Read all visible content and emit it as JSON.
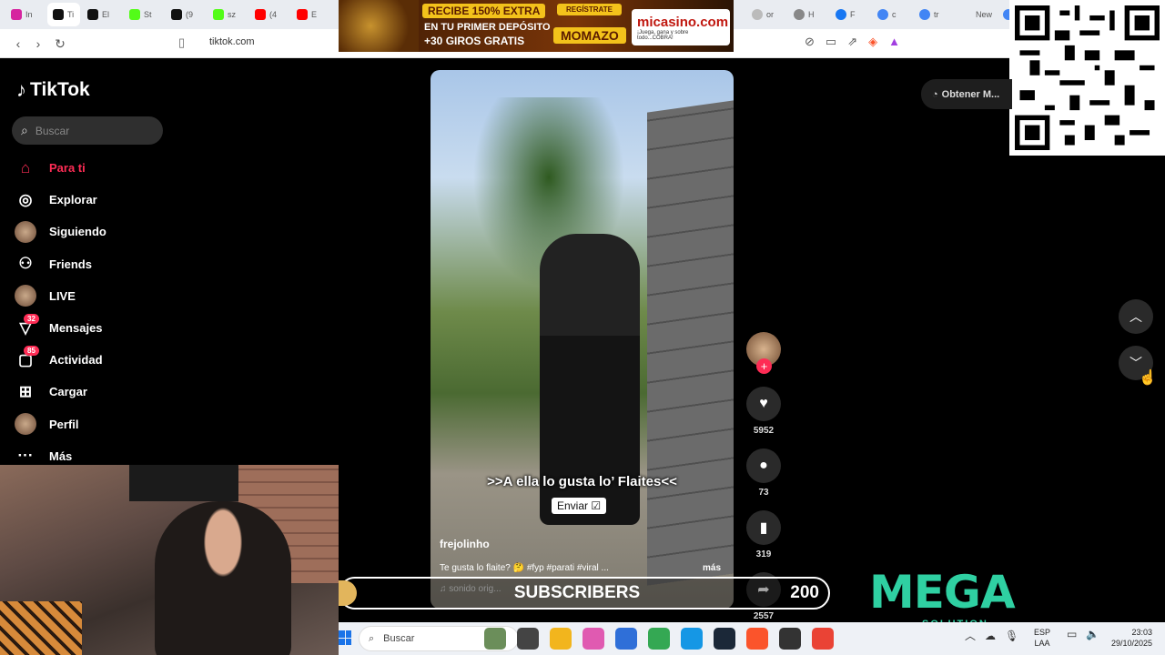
{
  "browser": {
    "tabs": [
      {
        "label": "In",
        "color": "#d6249f"
      },
      {
        "label": "Ti",
        "color": "#111111",
        "active": true
      },
      {
        "label": "El",
        "color": "#111111"
      },
      {
        "label": "St",
        "color": "#53fc18"
      },
      {
        "label": "(9",
        "color": "#111111"
      },
      {
        "label": "sz",
        "color": "#53fc18"
      },
      {
        "label": "(4",
        "color": "#ff0000"
      },
      {
        "label": "E",
        "color": "#ff0000"
      }
    ],
    "right_tabs": [
      {
        "label": "or",
        "color": "#bbbbbb"
      },
      {
        "label": "H",
        "color": "#888888"
      },
      {
        "label": "F",
        "color": "#1877f2"
      },
      {
        "label": "c",
        "color": "#4285f4"
      },
      {
        "label": "tr",
        "color": "#4285f4"
      },
      {
        "label": "New",
        "color": "#e9ecf1"
      },
      {
        "label": "G",
        "color": "#4285f4"
      }
    ],
    "url": "tiktok.com"
  },
  "ad": {
    "line1": "RECIBE 150% EXTRA",
    "line2": "EN TU PRIMER DEPÓSITO",
    "line3": "+30 GIROS GRATIS",
    "register": "REGÍSTRATE",
    "code": "MOMAZO",
    "brand": "micasino.com",
    "brand_tagline": "¡Juega, gana y sobre todo...COBRA!"
  },
  "tiktok": {
    "logo": "TikTok",
    "search_placeholder": "Buscar",
    "nav": [
      {
        "label": "Para ti",
        "icon": "home-icon",
        "glyph": "⌂",
        "active": true
      },
      {
        "label": "Explorar",
        "icon": "compass-icon",
        "glyph": "◎"
      },
      {
        "label": "Siguiendo",
        "icon": "following-avatar-icon",
        "glyph": ""
      },
      {
        "label": "Friends",
        "icon": "friends-icon",
        "glyph": "⚇"
      },
      {
        "label": "LIVE",
        "icon": "live-icon",
        "glyph": ""
      },
      {
        "label": "Mensajes",
        "icon": "messages-icon",
        "glyph": "▽",
        "badge": "32"
      },
      {
        "label": "Actividad",
        "icon": "activity-icon",
        "glyph": "▢",
        "badge": "85"
      },
      {
        "label": "Cargar",
        "icon": "upload-icon",
        "glyph": "⊞"
      },
      {
        "label": "Perfil",
        "icon": "profile-icon",
        "glyph": ""
      },
      {
        "label": "Más",
        "icon": "more-icon",
        "glyph": "···"
      }
    ],
    "obtener": "Obtener M...",
    "video": {
      "caption": ">>A ella lo gusta lo’ Flaites<<",
      "send_label": "Enviar",
      "author": "frejolinho",
      "description": "Te gusta lo flaite? 🤔 #fyp #parati #viral ...",
      "more": "más",
      "sound": "♫  sonido orig..."
    },
    "actions": {
      "likes": "5952",
      "comments": "73",
      "saves": "319",
      "shares": "2557"
    }
  },
  "overlay": {
    "subscribers_label": "SUBSCRIBERS",
    "subscribers_count": "200",
    "mega_logo": "MEGA",
    "mega_sub": "SOLUTION"
  },
  "taskbar": {
    "search": "Buscar",
    "lang_top": "ESP",
    "lang_bottom": "LAA",
    "time": "23:03",
    "date": "29/10/2025",
    "apps": [
      "#6b8e5a",
      "#444444",
      "#f2b51d",
      "#e05ab1",
      "#2f6fd8",
      "#34a853",
      "#1597e5",
      "#1b2838",
      "#fb542b",
      "#333333",
      "#ea4335"
    ]
  }
}
